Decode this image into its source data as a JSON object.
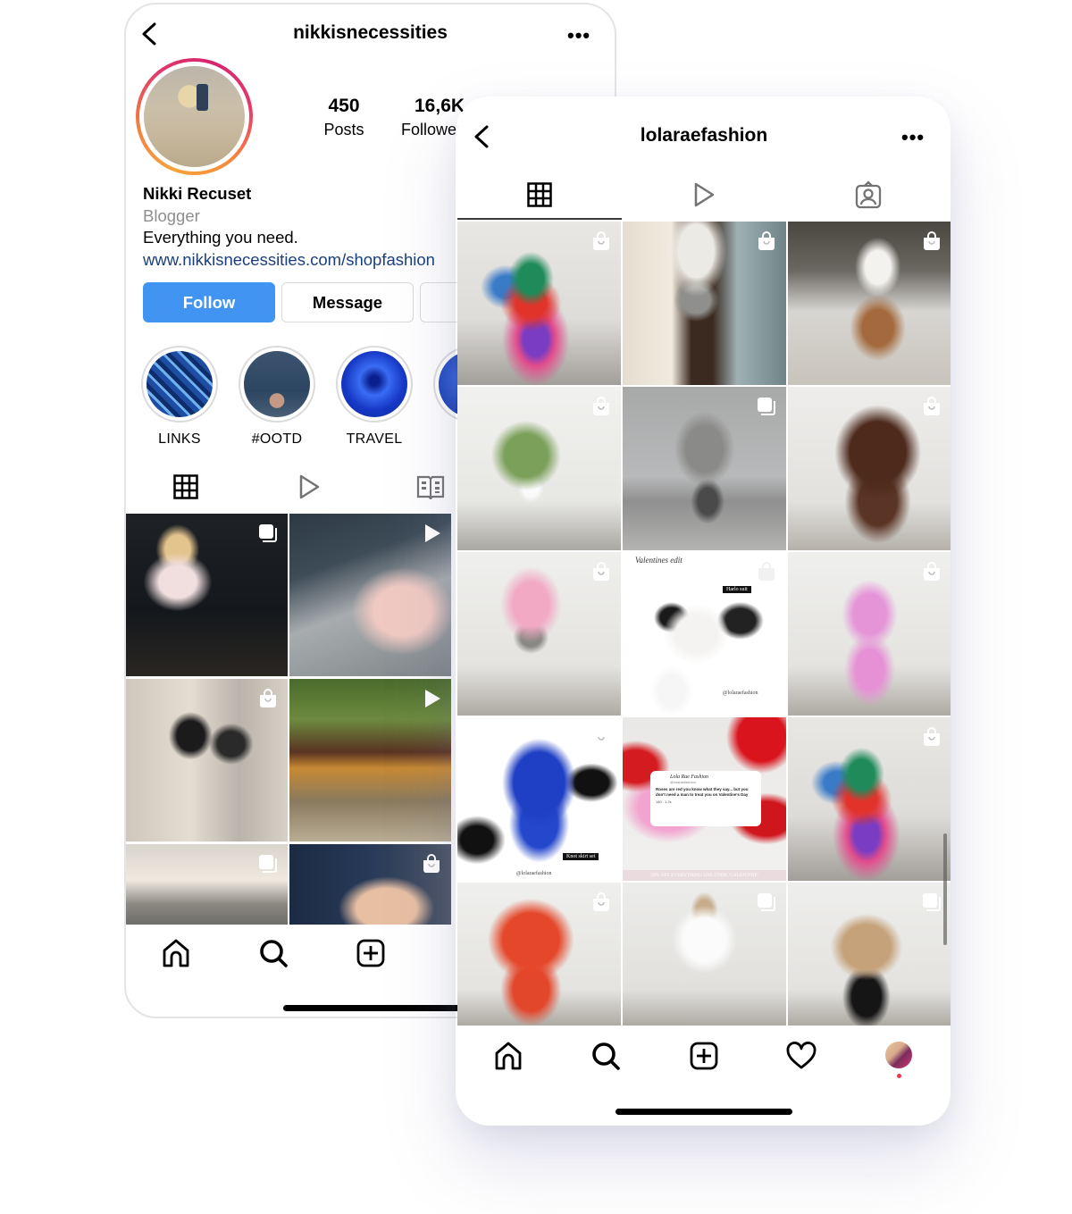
{
  "back_profile": {
    "username": "nikkisnecessities",
    "stats": [
      {
        "value": "450",
        "label": "Posts"
      },
      {
        "value": "16,6K",
        "label": "Followers"
      }
    ],
    "name": "Nikki Recuset",
    "category": "Blogger",
    "bio": "Everything you need.",
    "link": "www.nikkisnecessities.com/shopfashion",
    "buttons": {
      "follow": "Follow",
      "message": "Message"
    },
    "highlights": [
      {
        "label": "LINKS",
        "icon": "blue-mosaic-thumbnail"
      },
      {
        "label": "#OOTD",
        "icon": "denim-outfit-thumbnail"
      },
      {
        "label": "TRAVEL",
        "icon": "blue-tunnel-thumbnail"
      },
      {
        "label": "",
        "icon": "blue-texture-thumbnail"
      }
    ],
    "tabs": [
      {
        "name": "posts",
        "icon": "grid-icon",
        "active": true
      },
      {
        "name": "reels",
        "icon": "play-icon",
        "active": false
      },
      {
        "name": "guides",
        "icon": "guide-book-icon",
        "active": false
      }
    ],
    "posts": [
      {
        "description": "Blonde woman in sheer pink top at a bar",
        "badge": "carousel-icon"
      },
      {
        "description": "Pink manicured nails on grey knit",
        "badge": "reel-icon"
      },
      {
        "description": "Two girls mirror selfie in black tops",
        "badge": "shopping-bag-icon"
      },
      {
        "description": "Wooden shot bar with tequila outdoors",
        "badge": "reel-icon"
      },
      {
        "description": "Woman in hat on city street",
        "badge": "carousel-icon"
      },
      {
        "description": "Woman with long hair close-up",
        "badge": "shopping-bag-icon"
      }
    ],
    "nav": [
      "home-icon",
      "search-icon",
      "add-post-icon"
    ]
  },
  "front_profile": {
    "username": "lolaraefashion",
    "tabs": [
      {
        "name": "posts",
        "icon": "grid-icon",
        "active": true
      },
      {
        "name": "reels",
        "icon": "play-icon",
        "active": false
      },
      {
        "name": "tagged",
        "icon": "tagged-user-icon",
        "active": false
      }
    ],
    "posts": [
      {
        "description": "Multicolor tie-dye t-shirt and knot skirt",
        "badge": "shopping-bag-icon"
      },
      {
        "description": "White cropped blazer and grey shorts mirror selfie",
        "badge": "shopping-bag-icon"
      },
      {
        "description": "White top and tan leather trousers in living room",
        "badge": "shopping-bag-icon"
      },
      {
        "description": "Green satin wrap blouse with white shorts",
        "badge": "shopping-bag-icon"
      },
      {
        "description": "Grey blazer over hoodie and leggings",
        "badge": "carousel-icon"
      },
      {
        "description": "Brown t-shirt and knot skirt set",
        "badge": "shopping-bag-icon"
      },
      {
        "description": "Pink cropped jacket with grey shorts",
        "badge": "shopping-bag-icon"
      },
      {
        "description": "Valentines outfit collage",
        "badge": "shopping-bag-icon",
        "title": "Valentines edit",
        "tag": "Harlo suit",
        "credit": "@lolaraefashion"
      },
      {
        "description": "Pink blazer and trousers suit",
        "badge": "shopping-bag-icon"
      },
      {
        "description": "Royal blue knot skirt set collage",
        "badge": "shopping-bag-icon",
        "tag": "Knot skirt set",
        "credit": "@lolaraefashion"
      },
      {
        "description": "Valentine tweet graphic with pink suit and red heart balloons",
        "badge": "none",
        "tweet_author": "Lola Rae Fashion",
        "tweet_handle": "@lolaraefashion",
        "tweet_text": "Roses are red you know what they say... but you don't need a man to treat you on Valentine's Day",
        "tweet_comments": "180",
        "tweet_likes": "1.2k",
        "banner": "20% OFF EVERYTHING USE CODE 'GALENTINE'"
      },
      {
        "description": "Multicolor tie-dye t-shirt and skirt (repeat)",
        "badge": "shopping-bag-icon"
      },
      {
        "description": "Orange-red t-shirt and knot skirt",
        "badge": "shopping-bag-icon"
      },
      {
        "description": "White balloon sleeve blouse and shorts",
        "badge": "carousel-icon"
      },
      {
        "description": "Beige cropped jacket with black leggings and cap",
        "badge": "carousel-icon"
      }
    ],
    "nav": [
      "home-icon",
      "search-icon",
      "add-post-icon",
      "heart-icon",
      "profile-avatar"
    ]
  },
  "colors": {
    "follow_button": "#4294f2",
    "link": "#1b3f7b",
    "notification_dot": "#f0364b",
    "story_ring_start": "#f7a23a",
    "story_ring_end": "#d6246e"
  }
}
